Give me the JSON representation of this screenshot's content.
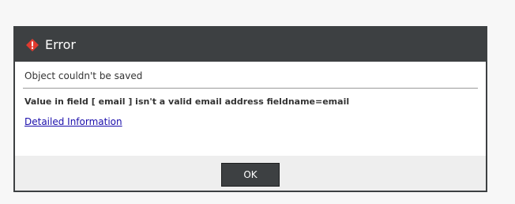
{
  "dialog": {
    "title": "Error",
    "message": "Object couldn't be saved",
    "detail": "Value in field [ email ] isn't a valid email address fieldname=email",
    "link_label": "Detailed Information",
    "ok_label": "OK",
    "icon": "error-diamond-icon"
  },
  "colors": {
    "titlebar": "#3d4042",
    "error_icon": "#e03a2f",
    "link": "#1a0dab",
    "footer": "#eeeeee"
  }
}
